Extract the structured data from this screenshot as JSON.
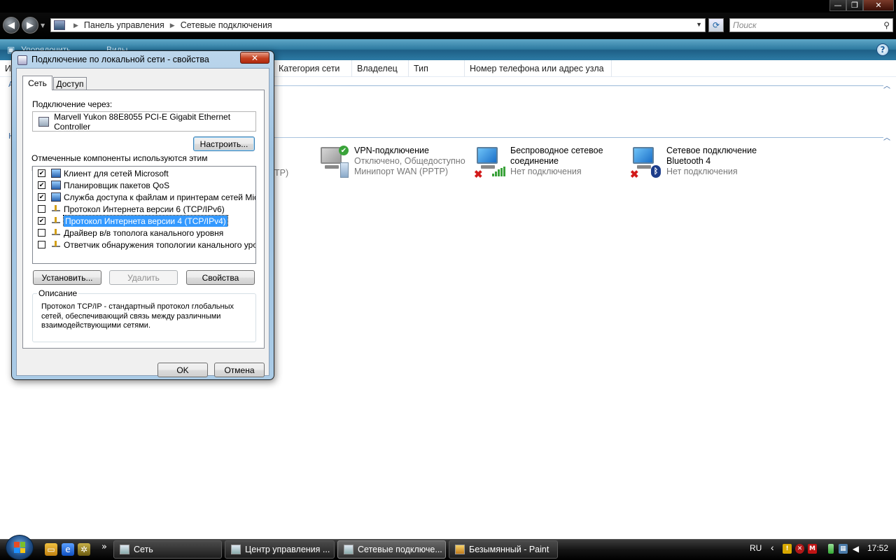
{
  "window": {
    "minimize_glyph": "—",
    "maximize_glyph": "❐",
    "close_glyph": "✕"
  },
  "address": {
    "root_icon": "control-panel-icon",
    "breadcrumb": [
      "Панель управления",
      "Сетевые подключения"
    ],
    "search_placeholder": "Поиск"
  },
  "cmdbar": {
    "organize_label": "Упорядочить",
    "views_label": "Виды",
    "help_glyph": "?"
  },
  "columns": {
    "hidden_first": "И",
    "category": "Категория сети",
    "owner": "Владелец",
    "type": "Тип",
    "phone": "Номер телефона или адрес узла"
  },
  "connections": [
    {
      "name": "VPN-подключение",
      "status": "Отключено, Общедоступно",
      "device": "Минипорт WAN (PPTP)"
    },
    {
      "name": "Беспроводное сетевое соединение",
      "name_line1": "Беспроводное сетевое",
      "name_line2": "соединение",
      "status": "Нет подключения"
    },
    {
      "name": "Сетевое подключение Bluetooth 4",
      "name_line1": "Сетевое подключение",
      "name_line2": "Bluetooth 4",
      "status": "Нет подключения"
    }
  ],
  "partial_text": {
    "ptp": "TP)",
    "left_letter_a": "А",
    "left_letter_h": "Н"
  },
  "dialog": {
    "title": "Подключение по локальной сети - свойства",
    "tabs": [
      "Сеть",
      "Доступ"
    ],
    "connect_via_label": "Подключение через:",
    "adapter": "Marvell Yukon 88E8055 PCI-E Gigabit Ethernet Controller",
    "configure_button": "Настроить...",
    "components_label": "Отмеченные компоненты используются этим подключением:",
    "components": [
      {
        "label": "Клиент для сетей Microsoft",
        "checked": true,
        "icon": "network-client-icon"
      },
      {
        "label": "Планировщик пакетов QoS",
        "checked": true,
        "icon": "qos-scheduler-icon"
      },
      {
        "label": "Служба доступа к файлам и принтерам сетей Micro...",
        "checked": true,
        "icon": "file-printer-sharing-icon"
      },
      {
        "label": "Протокол Интернета версии 6 (TCP/IPv6)",
        "checked": false,
        "icon": "protocol-icon"
      },
      {
        "label": "Протокол Интернета версии 4 (TCP/IPv4)",
        "checked": true,
        "icon": "protocol-icon",
        "selected": true
      },
      {
        "label": "Драйвер в/в тополога канального уровня",
        "checked": false,
        "icon": "protocol-icon"
      },
      {
        "label": "Ответчик обнаружения топологии канального уровня",
        "checked": false,
        "icon": "protocol-icon"
      }
    ],
    "check_glyph": "✔",
    "install_button": "Установить...",
    "remove_button": "Удалить",
    "properties_button": "Свойства",
    "description_legend": "Описание",
    "description": "Протокол TCP/IP - стандартный протокол глобальных сетей, обеспечивающий связь между различными взаимодействующими сетями.",
    "ok_button": "OK",
    "cancel_button": "Отмена"
  },
  "taskbar": {
    "quick_launch_more": "»",
    "buttons": [
      {
        "label": "Сеть",
        "active": false
      },
      {
        "label": "Центр управления ...",
        "active": false
      },
      {
        "label": "Сетевые подключе...",
        "active": true
      },
      {
        "label": "Безымянный - Paint",
        "active": false
      }
    ],
    "language": "RU",
    "tray_expand": "‹",
    "time": "17:52"
  }
}
